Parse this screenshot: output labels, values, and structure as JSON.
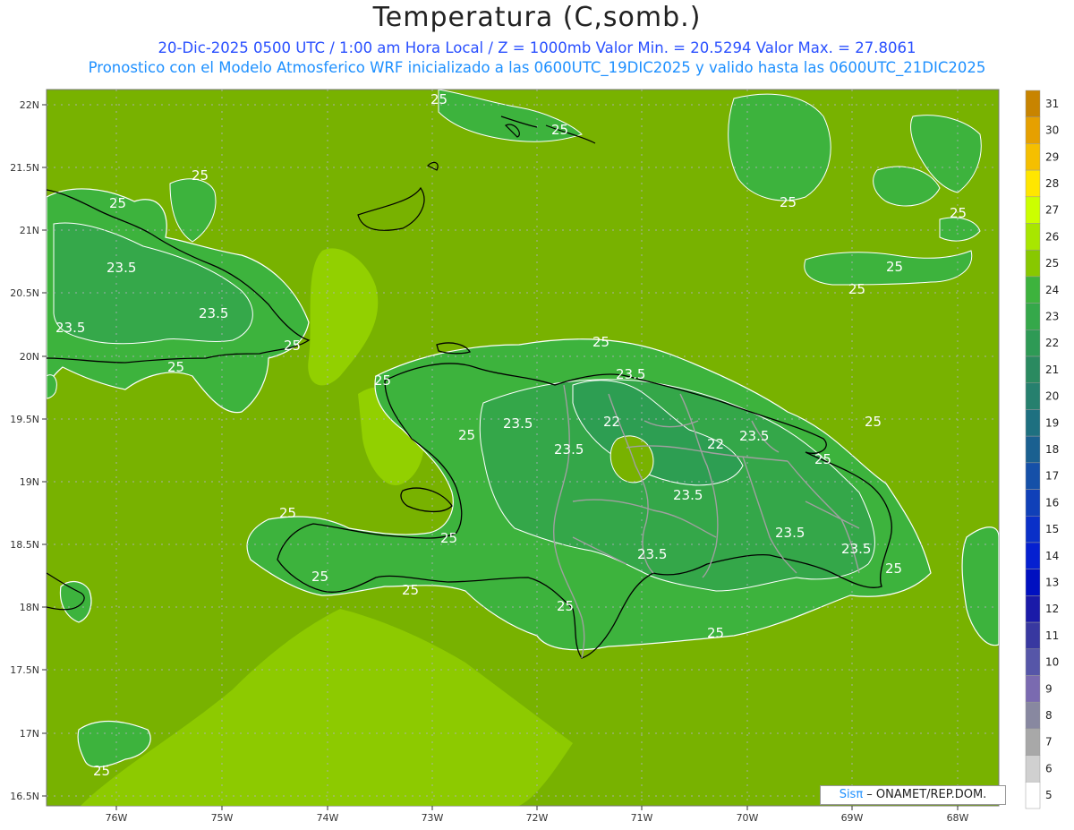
{
  "header": {
    "title": "Temperatura (C,somb.)",
    "line1": "20-Dic-2025  0500 UTC / 1:00 am Hora Local / Z = 1000mb   Valor Min. = 20.5294  Valor Max. = 27.8061",
    "line2": "Pronostico con el Modelo Atmosferico WRF inicializado a las 0600UTC_19DIC2025 y valido hasta las  0600UTC_21DIC2025"
  },
  "axes": {
    "lat_labels": [
      "22N",
      "21.5N",
      "21N",
      "20.5N",
      "20N",
      "19.5N",
      "19N",
      "18.5N",
      "18N",
      "17.5N",
      "17N",
      "16.5N"
    ],
    "lon_labels": [
      "76W",
      "75W",
      "74W",
      "73W",
      "72W",
      "71W",
      "70W",
      "69W",
      "68W"
    ]
  },
  "contour_labels": [
    "25",
    "23.5",
    "22"
  ],
  "colorbar": {
    "levels": [
      "31",
      "30",
      "29",
      "28",
      "27",
      "26",
      "25",
      "24",
      "23",
      "22",
      "21",
      "20",
      "19",
      "18",
      "17",
      "16",
      "15",
      "14",
      "13",
      "12",
      "11",
      "10",
      "9",
      "8",
      "7",
      "6",
      "5"
    ],
    "colors": [
      "#c88400",
      "#e6a000",
      "#f5bf00",
      "#ffe600",
      "#ccff00",
      "#a8e600",
      "#88c800",
      "#3db33d",
      "#35a84a",
      "#2e9a55",
      "#2a8a60",
      "#26806e",
      "#1e7080",
      "#1a6090",
      "#1550a8",
      "#1040b8",
      "#0a30c8",
      "#0520d0",
      "#0010c0",
      "#1a1aa8",
      "#3838a0",
      "#5656a8",
      "#7a6ab0",
      "#8888a0",
      "#a8a8a8",
      "#d0d0d0",
      "#ffffff"
    ]
  },
  "map_colors": {
    "sea_background": "#78b200",
    "band_25_24": "#3db33d",
    "band_24_23": "#34a749",
    "band_23_22": "#2d9e52",
    "warm_26": "#96d400",
    "coast": "#000000",
    "borders": "#a0a0a0",
    "contour": "#ffffff"
  },
  "credit": {
    "sis": "Sisπ",
    "rest": " – ONAMET/REP.DOM."
  }
}
